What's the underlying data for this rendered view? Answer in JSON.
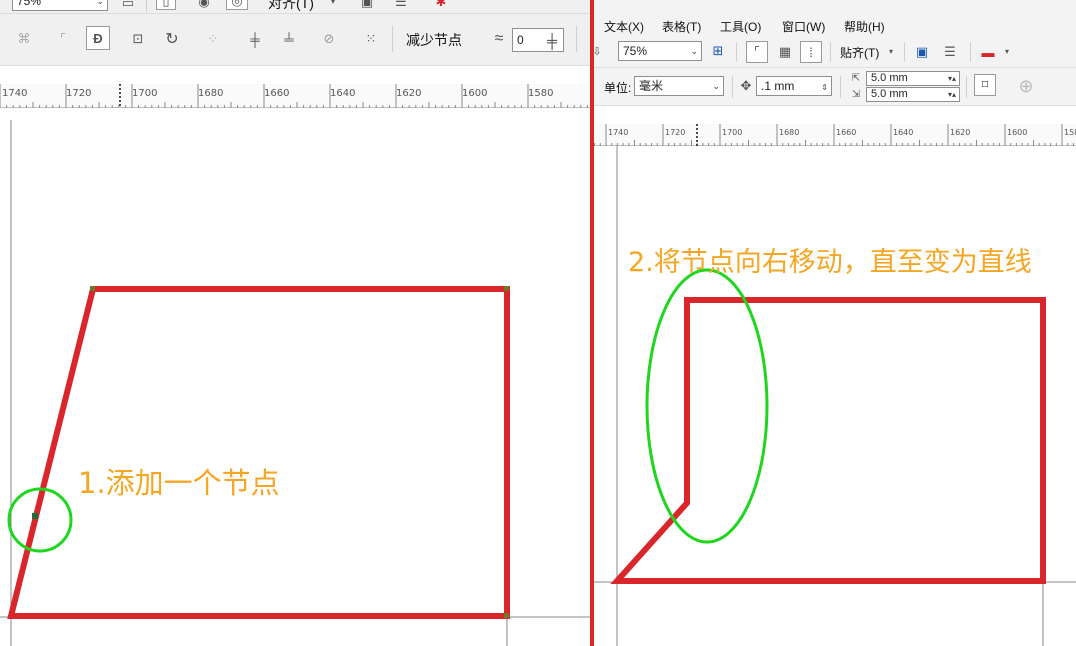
{
  "left": {
    "top_toolbar": {
      "zoom_value": "75%",
      "align_label": "对齐(T)"
    },
    "node_toolbar": {
      "reduce_nodes_label": "减少节点",
      "smoothness_value": "0"
    },
    "ruler": {
      "ticks": [
        "1740",
        "1720",
        "1700",
        "1680",
        "1660",
        "1640",
        "1620",
        "1600",
        "1580"
      ]
    },
    "annotation": "1.添加一个节点"
  },
  "right": {
    "menu": {
      "text": "文本(X)",
      "table": "表格(T)",
      "tools": "工具(O)",
      "window": "窗口(W)",
      "help": "帮助(H)"
    },
    "toolbar": {
      "zoom_value": "75%",
      "snap_label": "贴齐(T)"
    },
    "property_bar": {
      "unit_label": "单位:",
      "unit_value": "毫米",
      "nudge_value": ".1 mm",
      "dup_x_value": "5.0 mm",
      "dup_y_value": "5.0 mm"
    },
    "ruler": {
      "ticks": [
        "1740",
        "1720",
        "1700",
        "1680",
        "1660",
        "1640",
        "1620",
        "1600",
        "158"
      ]
    },
    "annotation": "2.将节点向右移动，直至变为直线"
  },
  "colors": {
    "shape_stroke": "#d9262b",
    "highlight_circle": "#1fd61f",
    "annotation_text": "#f5a623",
    "divider": "#d9262b"
  }
}
